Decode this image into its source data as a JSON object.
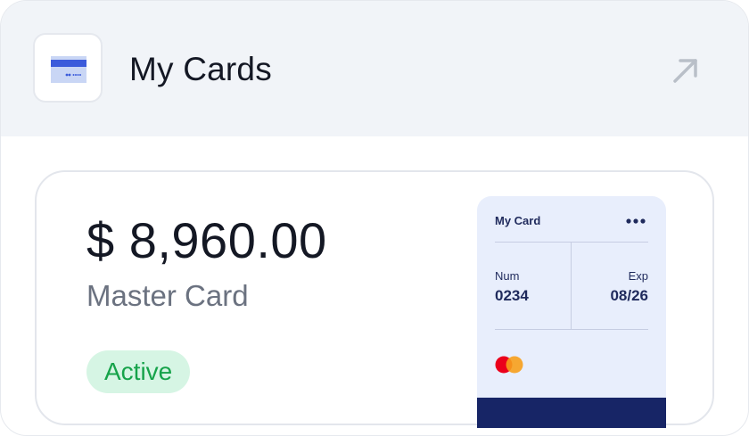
{
  "header": {
    "title": "My Cards",
    "icon": "credit-card-icon",
    "expand_icon": "arrow-up-right-icon"
  },
  "card_summary": {
    "balance": "$ 8,960.00",
    "card_type": "Master Card",
    "status": "Active"
  },
  "mini_card": {
    "title": "My Card",
    "menu_icon": "more-horizontal-icon",
    "num_label": "Num",
    "num_value": "0234",
    "exp_label": "Exp",
    "exp_value": "08/26",
    "brand_logo": "mastercard-logo"
  },
  "colors": {
    "accent_blue": "#3b5bdb",
    "card_navy": "#172566",
    "status_green": "#16a34a",
    "status_green_bg": "#d6f5e4",
    "mastercard_red": "#eb001b",
    "mastercard_orange": "#f79e1b"
  }
}
